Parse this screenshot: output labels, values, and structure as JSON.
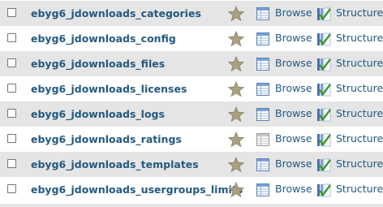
{
  "actions": {
    "browse_label": "Browse",
    "structure_label": "Structure"
  },
  "tables": [
    {
      "name": "ebyg6_jdownloads_categories",
      "browse_empty": false
    },
    {
      "name": "ebyg6_jdownloads_config",
      "browse_empty": false
    },
    {
      "name": "ebyg6_jdownloads_files",
      "browse_empty": false
    },
    {
      "name": "ebyg6_jdownloads_licenses",
      "browse_empty": false
    },
    {
      "name": "ebyg6_jdownloads_logs",
      "browse_empty": false
    },
    {
      "name": "ebyg6_jdownloads_ratings",
      "browse_empty": true
    },
    {
      "name": "ebyg6_jdownloads_templates",
      "browse_empty": false
    },
    {
      "name": "ebyg6_jdownloads_usergroups_limits",
      "browse_empty": false
    }
  ],
  "colors": {
    "link": "#235a81",
    "row_alt": "#e5e5e5",
    "star": "#a8a081",
    "structure_green": "#3a9a2e",
    "browse_blue": "#4a7fc1"
  },
  "icons": {
    "favorite": "star-icon",
    "browse": "browse-table-icon",
    "structure": "structure-icon"
  }
}
